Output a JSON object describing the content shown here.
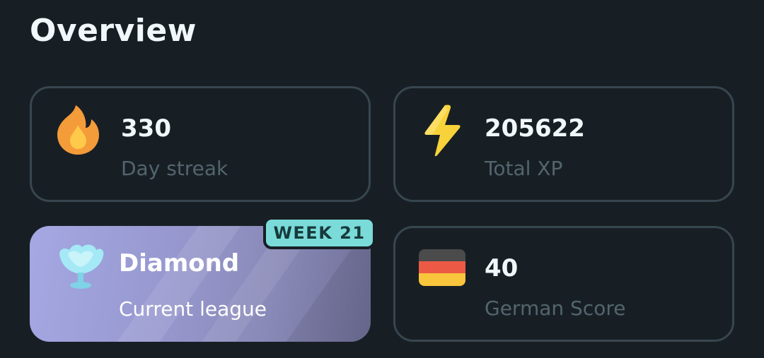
{
  "overview": {
    "title": "Overview"
  },
  "cards": {
    "streak": {
      "value": "330",
      "label": "Day streak",
      "icon": "flame-icon"
    },
    "xp": {
      "value": "205622",
      "label": "Total XP",
      "icon": "lightning-bolt-icon"
    },
    "league": {
      "value": "Diamond",
      "label": "Current league",
      "icon": "diamond-trophy-icon",
      "badge": "WEEK 21"
    },
    "score": {
      "value": "40",
      "label": "German Score",
      "icon": "german-flag-icon"
    }
  },
  "colors": {
    "background": "#181f24",
    "card_border": "#37464f",
    "label": "#52656d",
    "badge": "#7adbd8",
    "flame": "#f49b3a",
    "bolt": "#f7d23a"
  }
}
